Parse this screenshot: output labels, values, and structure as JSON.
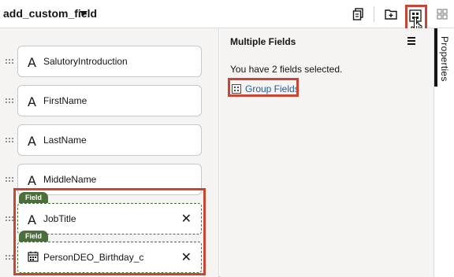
{
  "header": {
    "title": "add_custom_field",
    "toolbar": {
      "copy_icon": "copy-document-icon",
      "add_folder_icon": "add-container-icon",
      "group_icon": "group-fields-icon",
      "layout_icon": "layout-grid-icon"
    }
  },
  "canvas": {
    "fields": [
      {
        "label": "SalutoryIntroduction",
        "icon": "text-type-icon"
      },
      {
        "label": "FirstName",
        "icon": "text-type-icon"
      },
      {
        "label": "LastName",
        "icon": "text-type-icon"
      },
      {
        "label": "MiddleName",
        "icon": "text-type-icon"
      }
    ],
    "selected_fields": [
      {
        "badge": "Field",
        "label": "JobTitle",
        "icon": "text-type-icon"
      },
      {
        "badge": "Field",
        "label": "PersonDEO_Birthday_c",
        "icon": "calendar-icon"
      }
    ]
  },
  "panel": {
    "title": "Multiple Fields",
    "selected_text": "You have 2 fields selected.",
    "group_link": "Group Fields"
  },
  "side_tabs": {
    "properties": "Properties"
  },
  "colors": {
    "highlight": "#c74634",
    "badge": "#4b6e3a",
    "link": "#1e5a93"
  }
}
